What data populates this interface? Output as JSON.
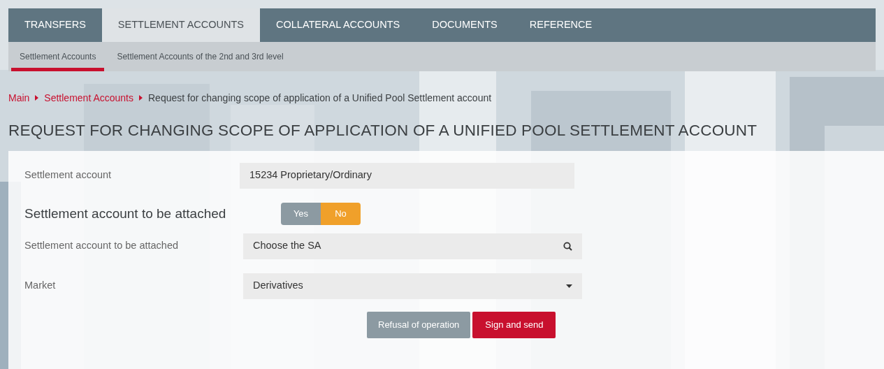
{
  "nav": {
    "tabs": [
      {
        "label": "TRANSFERS",
        "selected": false
      },
      {
        "label": "SETTLEMENT ACCOUNTS",
        "selected": true
      },
      {
        "label": "COLLATERAL ACCOUNTS",
        "selected": false
      },
      {
        "label": "DOCUMENTS",
        "selected": false
      },
      {
        "label": "REFERENCE",
        "selected": false
      }
    ]
  },
  "subnav": {
    "items": [
      {
        "label": "Settlement Accounts",
        "selected": true
      },
      {
        "label": "Settlement Accounts of the 2nd and 3rd level",
        "selected": false
      }
    ]
  },
  "breadcrumb": [
    {
      "label": "Main",
      "kind": "link"
    },
    {
      "label": "Settlement Accounts",
      "kind": "link"
    },
    {
      "label": "Request for changing scope of application of a Unified Pool Settlement account",
      "kind": "current"
    }
  ],
  "title": "REQUEST FOR CHANGING SCOPE OF APPLICATION OF A UNIFIED POOL SETTLEMENT ACCOUNT",
  "form": {
    "rows": [
      {
        "kind": "readonly",
        "label": "Settlement account",
        "value": "15234 Proprietary/Ordinary"
      },
      {
        "kind": "toggle",
        "label": "Settlement account to be attached",
        "options": [
          {
            "label": "Yes",
            "selected": false
          },
          {
            "label": "No",
            "selected": true
          }
        ]
      },
      {
        "kind": "search",
        "label": "Settlement account to be attached",
        "value": "Choose the SA"
      },
      {
        "kind": "select",
        "label": "Market",
        "value": "Derivatives"
      }
    ],
    "buttons": [
      {
        "label": "Refusal of operation",
        "kind": "secondary"
      },
      {
        "label": "Sign and send",
        "kind": "primary"
      }
    ]
  }
}
